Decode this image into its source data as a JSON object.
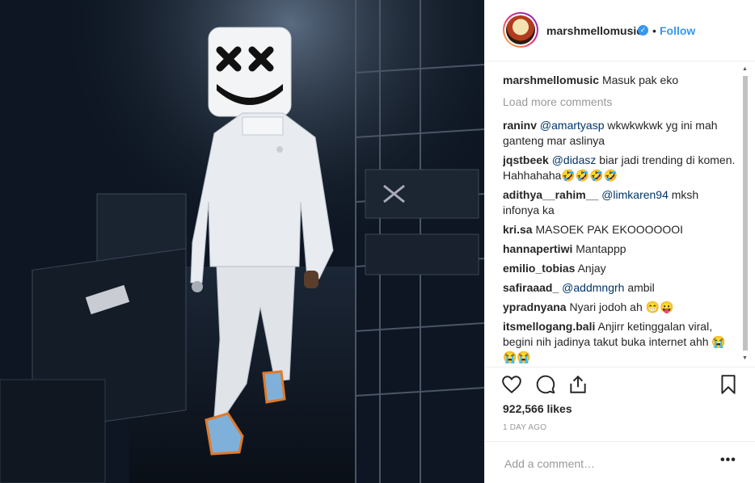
{
  "post": {
    "username": "marshmellomusic",
    "verified_icon": "verified-badge-icon",
    "separator": "•",
    "follow_label": "Follow",
    "caption": {
      "user": "marshmellomusic",
      "text": "Masuk pak eko"
    },
    "load_more": "Load more comments",
    "comments": [
      {
        "user": "raninv",
        "mention": "@amartyasp",
        "text": " wkwkwkwk yg ini mah ganteng mar aslinya"
      },
      {
        "user": "jqstbeek",
        "mention": "@didasz",
        "text": " biar jadi trending di komen. Hahhahaha🤣🤣🤣🤣"
      },
      {
        "user": "adithya__rahim__",
        "mention": "@limkaren94",
        "text": " mksh infonya ka"
      },
      {
        "user": "kri.sa",
        "mention": "",
        "text": " MASOEK PAK EKOOOOOOI"
      },
      {
        "user": "hannapertiwi",
        "mention": "",
        "text": " Mantappp"
      },
      {
        "user": "emilio_tobias",
        "mention": "",
        "text": " Anjay"
      },
      {
        "user": "safiraaad_",
        "mention": "@addmngrh",
        "text": " ambil"
      },
      {
        "user": "ypradnyana",
        "mention": "",
        "text": " Nyari jodoh ah 😁😛"
      },
      {
        "user": "itsmellogang.bali",
        "mention": "",
        "text": " Anjirr ketinggalan viral, begini nih jadinya takut buka internet ahh 😭😭😭"
      }
    ],
    "likes": "922,566 likes",
    "time_ago": "1 DAY AGO",
    "add_comment_placeholder": "Add a comment…",
    "more_label": "•••",
    "icons": {
      "like": "heart-icon",
      "comment": "comment-bubble-icon",
      "share": "share-icon",
      "save": "bookmark-icon"
    },
    "colors": {
      "link": "#3897f0",
      "mention": "#003569",
      "muted": "#999999"
    }
  }
}
